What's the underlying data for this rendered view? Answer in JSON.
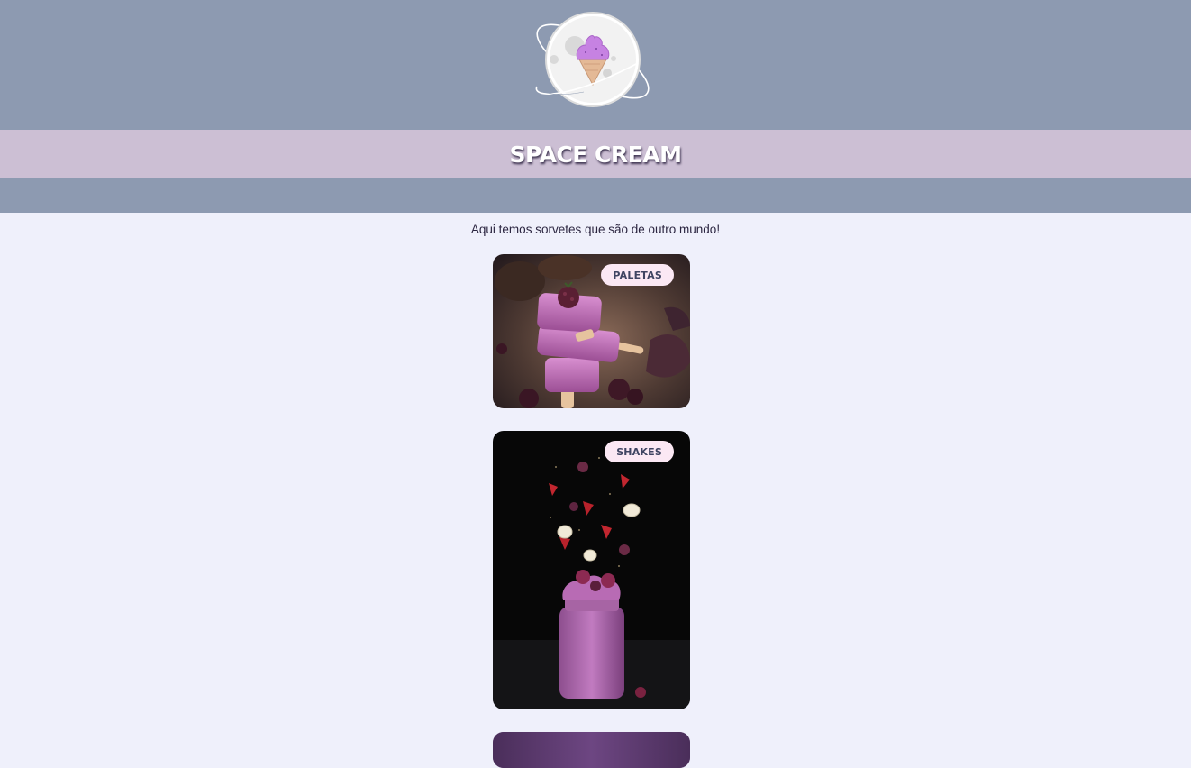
{
  "header": {
    "logo_icon": "ice-cream-planet-icon",
    "title": "SPACE CREAM"
  },
  "tagline": "Aqui temos sorvetes que são de outro mundo!",
  "cards": [
    {
      "label": "PALETAS",
      "image": "popsicles-photo"
    },
    {
      "label": "SHAKES",
      "image": "milkshake-jar-photo"
    },
    {
      "label": "",
      "image": "partial-photo"
    }
  ],
  "colors": {
    "header_bg": "#8d9ab1",
    "title_bar_bg": "#ccbfd4",
    "page_bg": "#eff0fb",
    "badge_bg": "#fbe8f4",
    "badge_text": "#3f4462"
  }
}
